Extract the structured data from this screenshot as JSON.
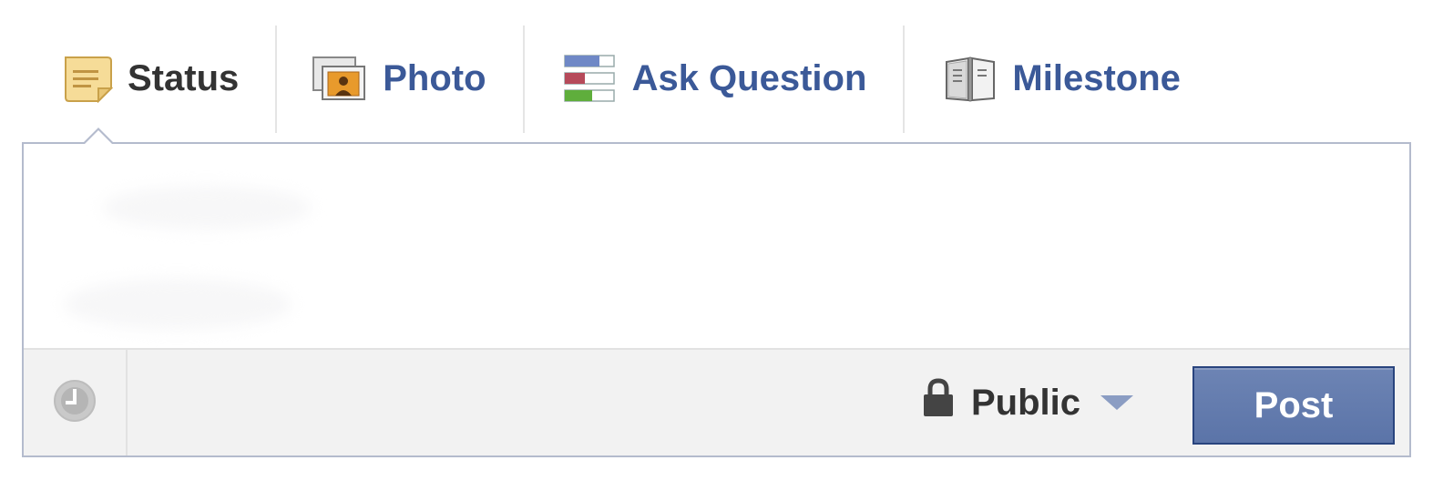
{
  "tabs": [
    {
      "label": "Status",
      "icon": "note-icon",
      "active": true
    },
    {
      "label": "Photo",
      "icon": "photo-icon",
      "active": false
    },
    {
      "label": "Ask Question",
      "icon": "question-poll-icon",
      "active": false
    },
    {
      "label": "Milestone",
      "icon": "book-icon",
      "active": false
    }
  ],
  "composer": {
    "text": "",
    "placeholder": ""
  },
  "footer": {
    "schedule_icon": "clock-icon",
    "privacy": {
      "label": "Public",
      "icon": "lock-icon"
    },
    "post_label": "Post"
  },
  "colors": {
    "link": "#3b5998",
    "active_text": "#333333",
    "button_bg": "#5b74a8",
    "button_border": "#29447e",
    "box_border": "#b4bbcd",
    "footer_bg": "#f2f2f2"
  }
}
